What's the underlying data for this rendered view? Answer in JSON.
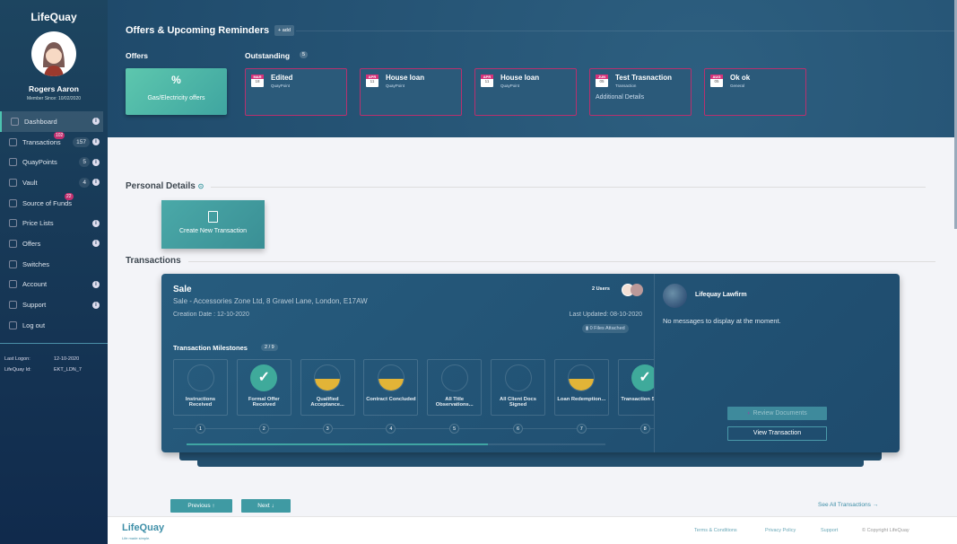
{
  "sidebar": {
    "logo": "LifeQuay",
    "user_name": "Rogers Aaron",
    "member_since": "Member Since: 10/02/2020",
    "items": [
      {
        "label": "Dashboard",
        "count": "",
        "badge": "",
        "info": true,
        "active": true
      },
      {
        "label": "Transactions",
        "count": "157",
        "badge": "102",
        "info": true
      },
      {
        "label": "QuayPoints",
        "count": "5",
        "badge": "",
        "info": true
      },
      {
        "label": "Vault",
        "count": "4",
        "badge": "",
        "info": true
      },
      {
        "label": "Source of Funds",
        "count": "",
        "badge": "22",
        "info": false
      },
      {
        "label": "Price Lists",
        "count": "",
        "badge": "",
        "info": true
      },
      {
        "label": "Offers",
        "count": "",
        "badge": "",
        "info": true
      },
      {
        "label": "Switches",
        "count": "",
        "badge": "",
        "info": false
      },
      {
        "label": "Account",
        "count": "",
        "badge": "",
        "info": true
      },
      {
        "label": "Support",
        "count": "",
        "badge": "",
        "info": true
      },
      {
        "label": "Log out",
        "count": "",
        "badge": "",
        "info": false
      }
    ],
    "last_logon_label": "Last Logon:",
    "last_logon": "12-10-2020",
    "id_label": "LifeQuay Id:",
    "id": "EKT_LDN_7"
  },
  "reminders": {
    "title": "Offers & Upcoming Reminders",
    "add_label": "+ add",
    "offers_label": "Offers",
    "offer_card": "Gas/Electricity offers",
    "outstanding_label": "Outstanding",
    "outstanding_count": "5",
    "items": [
      {
        "month": "MAR",
        "day": "18",
        "title": "Edited",
        "type": "QuayPoint",
        "details": ""
      },
      {
        "month": "APR",
        "day": "11",
        "title": "House loan",
        "type": "QuayPoint",
        "details": ""
      },
      {
        "month": "APR",
        "day": "11",
        "title": "House loan",
        "type": "QuayPoint",
        "details": ""
      },
      {
        "month": "JUN",
        "day": "05",
        "title": "Test Trasnaction",
        "type": "Transaction",
        "details": "Additional Details"
      },
      {
        "month": "AUG",
        "day": "05",
        "title": "Ok ok",
        "type": "General",
        "details": ""
      }
    ]
  },
  "personal": {
    "title": "Personal Details",
    "create_label": "Create New Transaction"
  },
  "transactions": {
    "title": "Transactions",
    "card": {
      "type": "Sale",
      "address": "Sale - Accessories Zone Ltd, 8 Gravel Lane, London, E17AW",
      "created": "Creation Date : 12-10-2020",
      "updated": "Last Updated: 08-10-2020",
      "users": "2 Users",
      "files": "0 Files Attached",
      "milestones_label": "Transaction Milestones",
      "milestones_count": "2 / 9",
      "progress": 0.72,
      "milestones": [
        {
          "n": "1",
          "label": "Instructions Received",
          "state": "empty"
        },
        {
          "n": "2",
          "label": "Formal Offer Received",
          "state": "done"
        },
        {
          "n": "3",
          "label": "Qualified Acceptance...",
          "state": "half"
        },
        {
          "n": "4",
          "label": "Contract Concluded",
          "state": "half"
        },
        {
          "n": "5",
          "label": "All Title Observations...",
          "state": "empty"
        },
        {
          "n": "6",
          "label": "All Client Docs Signed",
          "state": "empty"
        },
        {
          "n": "7",
          "label": "Loan Redemption...",
          "state": "half"
        },
        {
          "n": "8",
          "label": "Transaction Settled",
          "state": "done"
        }
      ],
      "firm": "Lifequay Lawfirm",
      "no_messages": "No messages to display at the moment.",
      "review_label": "Review Documents",
      "view_label": "View Transaction"
    },
    "prev_label": "Previous ↑",
    "next_label": "Next ↓",
    "see_all": "See All Transactions →"
  },
  "footer": {
    "logo": "LifeQuay",
    "tagline": "Life made simple.",
    "links": [
      "Terms & Conditions",
      "Privacy Policy",
      "Support",
      "© Copyright LifeQuay"
    ]
  },
  "colors": {
    "accent": "#3f9aa3",
    "pink": "#d6337a",
    "navy": "#1f4a6b",
    "yellow": "#e2b437",
    "green": "#3faa9b"
  }
}
